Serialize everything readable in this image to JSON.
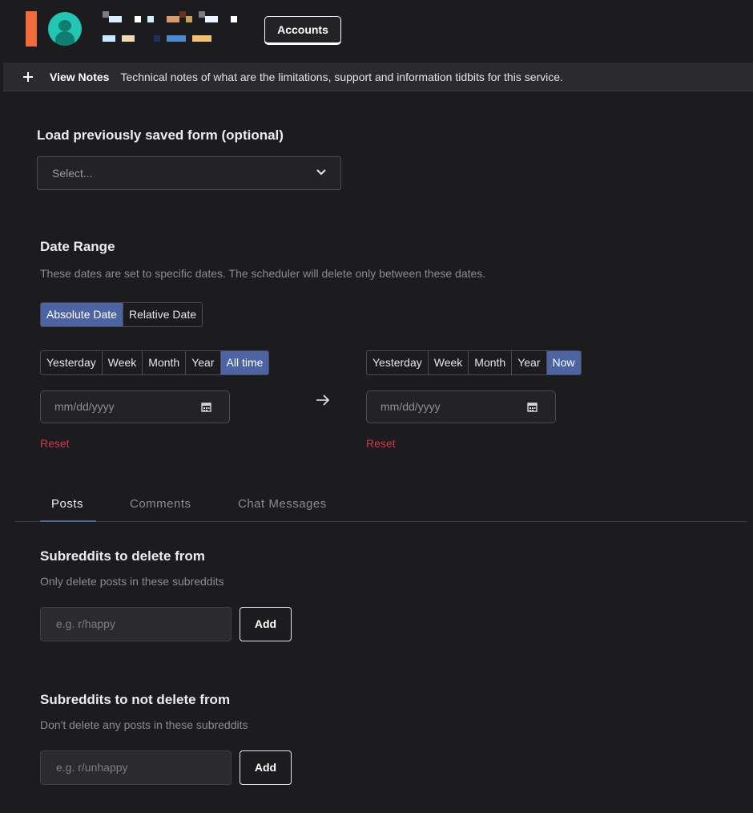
{
  "header": {
    "accounts_label": "Accounts",
    "brand_color": "#f26b3a",
    "avatar_color": "#22c6b2"
  },
  "notes": {
    "toggle_icon": "plus-icon",
    "label": "View Notes",
    "text": "Technical notes of what are the limitations, support and information tidbits for this service."
  },
  "saved_form": {
    "label": "Load previously saved form (optional)",
    "placeholder": "Select..."
  },
  "date_range": {
    "title": "Date Range",
    "description": "These dates are set to specific dates. The scheduler will delete only between these dates.",
    "mode_tabs": [
      {
        "label": "Absolute Date",
        "active": true
      },
      {
        "label": "Relative Date",
        "active": false
      }
    ],
    "start": {
      "presets": [
        {
          "label": "Yesterday",
          "active": false
        },
        {
          "label": "Week",
          "active": false
        },
        {
          "label": "Month",
          "active": false
        },
        {
          "label": "Year",
          "active": false
        },
        {
          "label": "All time",
          "active": true
        }
      ],
      "placeholder": "mm/dd/yyyy",
      "reset_label": "Reset"
    },
    "end": {
      "presets": [
        {
          "label": "Yesterday",
          "active": false
        },
        {
          "label": "Week",
          "active": false
        },
        {
          "label": "Month",
          "active": false
        },
        {
          "label": "Year",
          "active": false
        },
        {
          "label": "Now",
          "active": true
        }
      ],
      "placeholder": "mm/dd/yyyy",
      "reset_label": "Reset"
    },
    "accent_color": "#4c63a4",
    "reset_color": "#d0364a"
  },
  "content_tabs": [
    {
      "label": "Posts",
      "active": true
    },
    {
      "label": "Comments",
      "active": false
    },
    {
      "label": "Chat Messages",
      "active": false
    }
  ],
  "include_subreddits": {
    "title": "Subreddits to delete from",
    "description": "Only delete posts in these subreddits",
    "placeholder": "e.g. r/happy",
    "add_label": "Add"
  },
  "exclude_subreddits": {
    "title": "Subreddits to not delete from",
    "description": "Don't delete any posts in these subreddits",
    "placeholder": "e.g. r/unhappy",
    "add_label": "Add"
  }
}
